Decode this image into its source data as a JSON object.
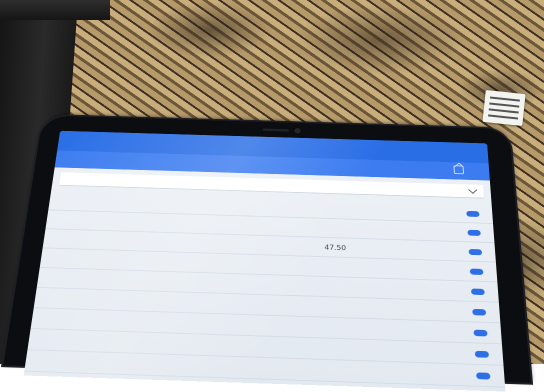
{
  "app_bar": {
    "title": ""
  },
  "header": {
    "title": "",
    "share_label": ""
  },
  "student_select": {
    "value": ""
  },
  "table": {
    "headers": {
      "name": "",
      "score": "",
      "status": ""
    },
    "rows": [
      {
        "name": "",
        "score": ""
      },
      {
        "name": "",
        "score": ""
      },
      {
        "name": "",
        "score": "47.50"
      },
      {
        "name": "",
        "score": ""
      },
      {
        "name": "",
        "score": ""
      },
      {
        "name": "",
        "score": ""
      },
      {
        "name": "",
        "score": ""
      },
      {
        "name": "",
        "score": ""
      },
      {
        "name": "",
        "score": ""
      },
      {
        "name": "",
        "score": ""
      }
    ]
  },
  "colors": {
    "primary": "#2a6ee6",
    "header": "#3c7cf0",
    "screen_bg": "#eef2f7"
  }
}
